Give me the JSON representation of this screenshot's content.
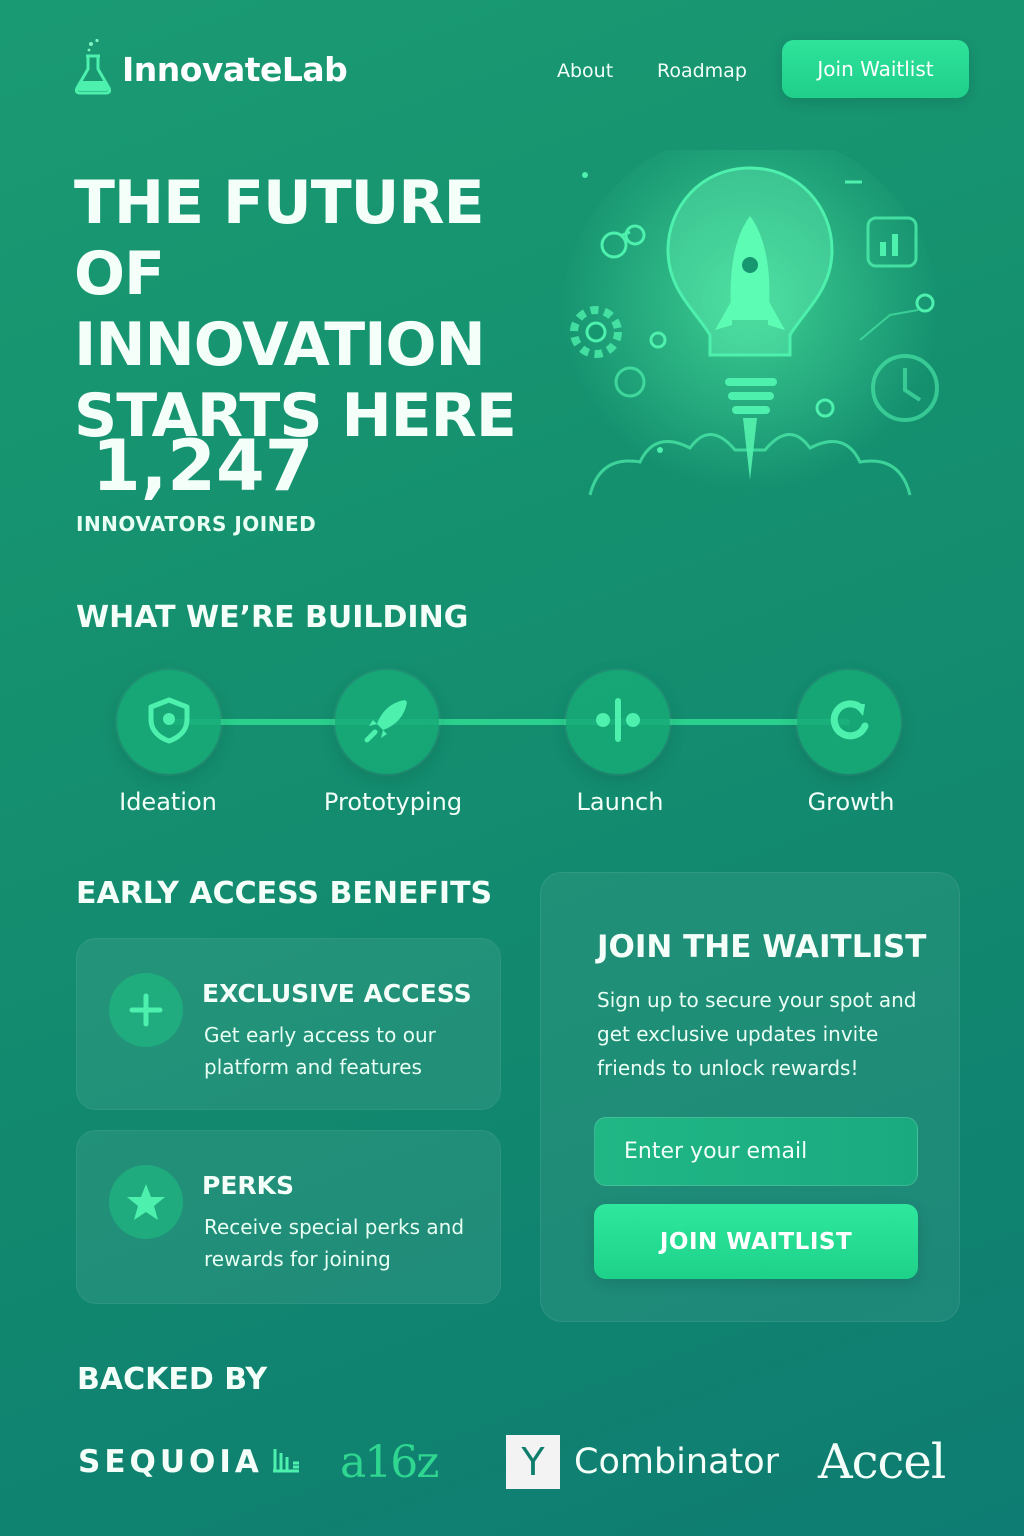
{
  "brand": {
    "name": "InnovateLab",
    "icon": "flask-icon"
  },
  "nav": {
    "links": [
      "About",
      "Roadmap"
    ],
    "cta": "Join Waitlist"
  },
  "hero": {
    "title_lines": [
      "THE FUTURE",
      "OF INNOVATION",
      "STARTS HERE"
    ],
    "count": "1,247",
    "count_label": "INNOVATORS JOINED",
    "illustration": "rocket-lightbulb-icon"
  },
  "building": {
    "heading": "WHAT WE’RE BUILDING",
    "steps": [
      {
        "label": "Ideation",
        "icon": "shield-icon"
      },
      {
        "label": "Prototyping",
        "icon": "rocket-icon"
      },
      {
        "label": "Launch",
        "icon": "launch-icon"
      },
      {
        "label": "Growth",
        "icon": "growth-icon"
      }
    ]
  },
  "benefits": {
    "heading": "EARLY ACCESS BENEFITS",
    "items": [
      {
        "title": "EXCLUSIVE ACCESS",
        "desc": "Get early access to our platform and features",
        "icon": "plus-icon"
      },
      {
        "title": "PERKS",
        "desc": "Receive special perks and rewards for joining",
        "icon": "star-icon"
      }
    ]
  },
  "waitlist": {
    "title": "JOIN THE WAITLIST",
    "desc": "Sign up to secure your spot and get exclusive updates invite friends to unlock rewards!",
    "placeholder": "Enter your email",
    "button": "JOIN WAITLIST"
  },
  "backers": {
    "heading": "BACKED BY",
    "logos": [
      "SEQUOIA",
      "a16z",
      "Y",
      "Combinator",
      "Accel"
    ]
  },
  "colors": {
    "accent": "#2fe39b",
    "background": "#15916f",
    "text": "#ffffff"
  }
}
